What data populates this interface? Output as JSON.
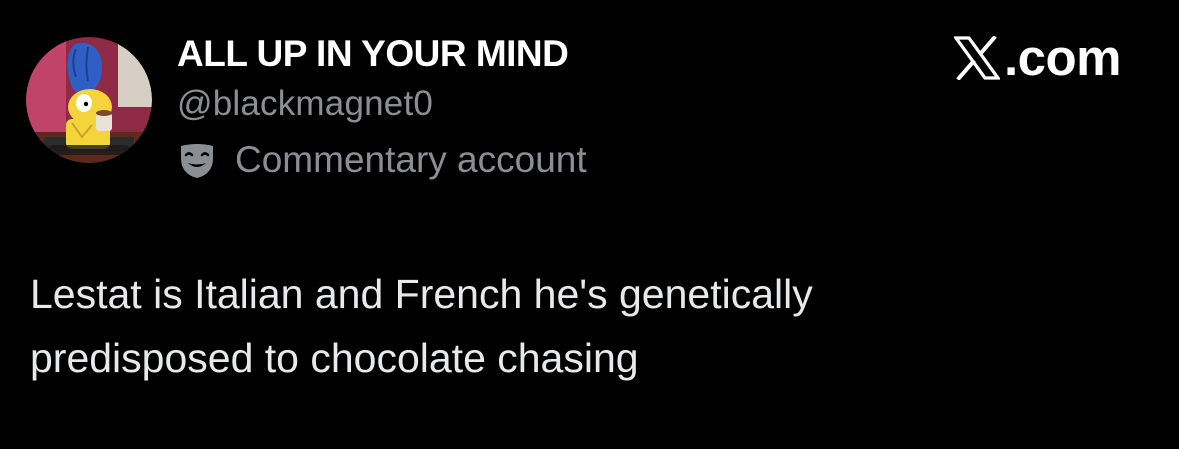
{
  "author": {
    "display_name": "ALL UP IN YOUR MIND",
    "handle": "@blackmagnet0",
    "account_label": "Commentary account",
    "account_label_icon": "theater-mask-icon",
    "avatar": "cartoon-character-avatar"
  },
  "brand": {
    "logo_icon": "x-logo-icon",
    "text": ".com"
  },
  "tweet": {
    "lines": [
      "Lestat is Italian and French he's genetically",
      "predisposed to chocolate chasing"
    ]
  },
  "colors": {
    "background": "#000000",
    "primary_text": "#e7e9ea",
    "secondary_text": "#8b8f94",
    "name_text": "#ffffff"
  }
}
